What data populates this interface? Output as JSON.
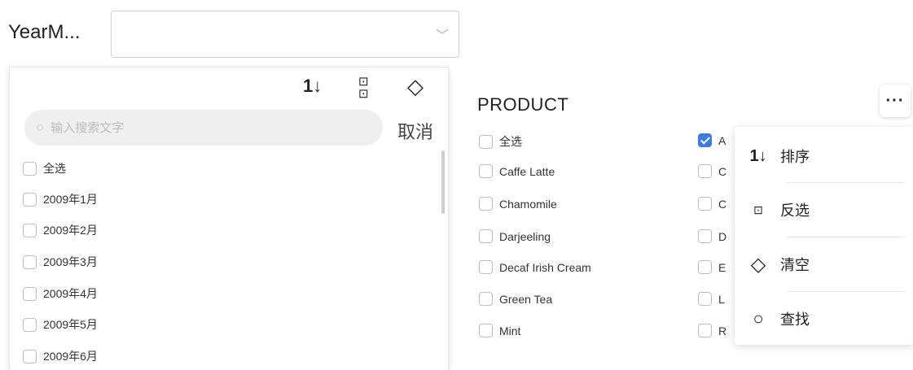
{
  "filter": {
    "label": "YearM...",
    "selected_value": "",
    "chevron_icon": "chevron-down-icon"
  },
  "panel": {
    "toolbar": {
      "sort_icon": "1↓",
      "invert_icon": "▫▫",
      "clear_icon": "◇"
    },
    "search_placeholder": "输入搜索文字",
    "cancel_label": "取消",
    "options": [
      {
        "label": "全选",
        "checked": false
      },
      {
        "label": "2009年1月",
        "checked": false
      },
      {
        "label": "2009年2月",
        "checked": false
      },
      {
        "label": "2009年3月",
        "checked": false
      },
      {
        "label": "2009年4月",
        "checked": false
      },
      {
        "label": "2009年5月",
        "checked": false
      },
      {
        "label": "2009年6月",
        "checked": false
      }
    ]
  },
  "product": {
    "title": "PRODUCT",
    "col1": [
      {
        "label": "全选",
        "checked": false
      },
      {
        "label": "Caffe Latte",
        "checked": false
      },
      {
        "label": "Chamomile",
        "checked": false
      },
      {
        "label": "Darjeeling",
        "checked": false
      },
      {
        "label": "Decaf Irish Cream",
        "checked": false
      },
      {
        "label": "Green Tea",
        "checked": false
      },
      {
        "label": "Mint",
        "checked": false
      }
    ],
    "col2": [
      {
        "label": "A",
        "checked": true
      },
      {
        "label": "C",
        "checked": false
      },
      {
        "label": "C",
        "checked": false
      },
      {
        "label": "D",
        "checked": false
      },
      {
        "label": "E",
        "checked": false
      },
      {
        "label": "L",
        "checked": false
      },
      {
        "label": "R",
        "checked": false
      }
    ],
    "more_label": "···"
  },
  "menu": {
    "items": [
      {
        "label": "排序",
        "icon": "sort-icon"
      },
      {
        "label": "反选",
        "icon": "invert-select-icon"
      },
      {
        "label": "清空",
        "icon": "eraser-icon"
      },
      {
        "label": "查找",
        "icon": "search-icon"
      }
    ]
  },
  "colors": {
    "accent": "#3d7ae4",
    "search_bg": "#efefef"
  }
}
